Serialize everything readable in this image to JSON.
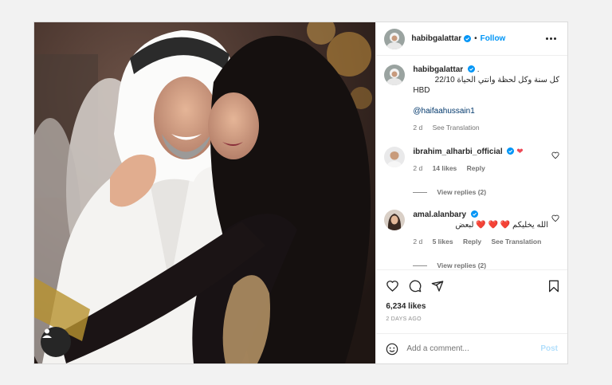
{
  "post": {
    "username": "habibgalattar",
    "follow_label": "Follow",
    "separator": "•",
    "caption": {
      "username": "habibgalattar",
      "suffix": ".",
      "text_rtl": "كل سنة وكل لحظة وانتي الحياة 22/10",
      "text_ltr": "HBD",
      "mention": "@haifaahussain1",
      "time": "2 d",
      "see_translation": "See Translation"
    },
    "comments": [
      {
        "username": "ibrahim_alharbi_official",
        "text": "❤",
        "time": "2 d",
        "likes": "14 likes",
        "reply": "Reply",
        "view_replies": "View replies (2)"
      },
      {
        "username": "amal.alanbary",
        "text_rtl": "الله يخليكم ❤️ ❤️ ❤️ لبعض",
        "time": "2 d",
        "likes": "5 likes",
        "reply": "Reply",
        "see_translation": "See Translation",
        "view_replies": "View replies (2)"
      }
    ],
    "likes_count": "6,234 likes",
    "date": "2 DAYS AGO",
    "add_comment_placeholder": "Add a comment...",
    "post_label": "Post"
  },
  "icons": {
    "like": "heart-icon",
    "comment": "comment-icon",
    "share": "share-icon",
    "save": "bookmark-icon",
    "more": "more-icon",
    "emoji": "emoji-icon",
    "tag": "tag-user-icon",
    "verified": "verified-badge-icon"
  },
  "colors": {
    "accent": "#0095f6",
    "heart": "#ed4956",
    "muted": "#737373"
  }
}
